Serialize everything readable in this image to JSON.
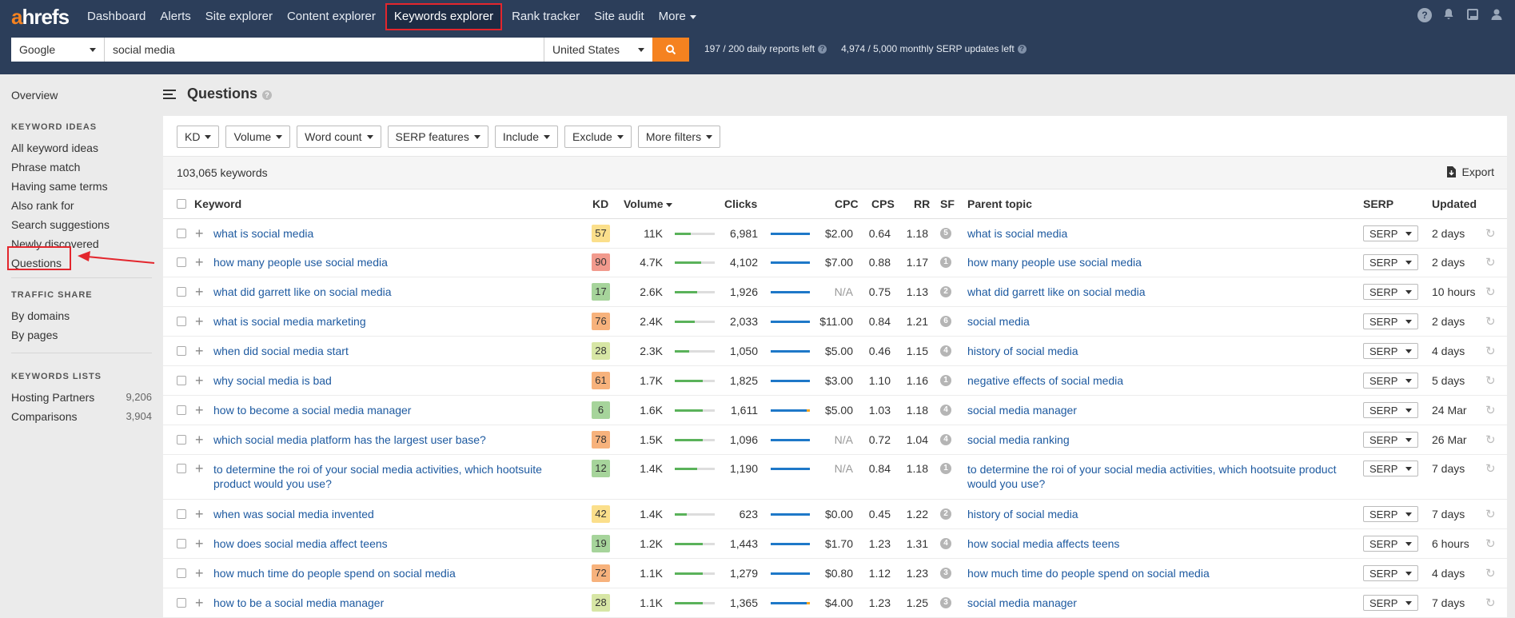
{
  "brand": {
    "logo_first": "a",
    "logo_rest": "hrefs",
    "accent": "#f58220",
    "nav_bg": "#2c3e5a"
  },
  "nav": {
    "items": [
      "Dashboard",
      "Alerts",
      "Site explorer",
      "Content explorer",
      "Keywords explorer",
      "Rank tracker",
      "Site audit",
      "More"
    ],
    "active": "Keywords explorer"
  },
  "top_icons": [
    "help-icon",
    "bell-icon",
    "book-icon",
    "user-icon"
  ],
  "search": {
    "engine": "Google",
    "query": "social media",
    "country": "United States",
    "daily_reports": "197 / 200 daily reports left",
    "monthly_updates": "4,974 / 5,000 monthly SERP updates left"
  },
  "sidebar": {
    "overview": "Overview",
    "keyword_ideas_heading": "KEYWORD IDEAS",
    "keyword_ideas": [
      "All keyword ideas",
      "Phrase match",
      "Having same terms",
      "Also rank for",
      "Search suggestions",
      "Newly discovered",
      "Questions"
    ],
    "traffic_share_heading": "TRAFFIC SHARE",
    "traffic_share": [
      "By domains",
      "By pages"
    ],
    "lists_heading": "KEYWORDS LISTS",
    "lists": [
      {
        "name": "Hosting Partners",
        "count": "9,206"
      },
      {
        "name": "Comparisons",
        "count": "3,904"
      }
    ]
  },
  "page": {
    "title": "Questions",
    "keyword_count": "103,065 keywords",
    "export_label": "Export"
  },
  "filters": [
    "KD",
    "Volume",
    "Word count",
    "SERP features",
    "Include",
    "Exclude",
    "More filters"
  ],
  "columns": {
    "keyword": "Keyword",
    "kd": "KD",
    "volume": "Volume",
    "clicks": "Clicks",
    "cpc": "CPC",
    "cps": "CPS",
    "rr": "RR",
    "sf": "SF",
    "parent_topic": "Parent topic",
    "serp": "SERP",
    "updated": "Updated"
  },
  "kd_colors": {
    "easy": "#a6d49b",
    "low": "#d7e6a5",
    "medium": "#fbdf8b",
    "hard": "#f7b27c",
    "super_hard": "#f29a8d"
  },
  "rows": [
    {
      "keyword": "what is social media",
      "kd": "57",
      "kd_color": "#fbdf8b",
      "volume": "11K",
      "vol_fill": 0.4,
      "clicks": "6,981",
      "paid": 0,
      "cpc": "$2.00",
      "cps": "0.64",
      "rr": "1.18",
      "sf": "5",
      "parent": "what is social media",
      "serp": "SERP",
      "updated": "2 days"
    },
    {
      "keyword": "how many people use social media",
      "kd": "90",
      "kd_color": "#f29a8d",
      "volume": "4.7K",
      "vol_fill": 0.65,
      "clicks": "4,102",
      "paid": 0,
      "cpc": "$7.00",
      "cps": "0.88",
      "rr": "1.17",
      "sf": "1",
      "parent": "how many people use social media",
      "serp": "SERP",
      "updated": "2 days"
    },
    {
      "keyword": "what did garrett like on social media",
      "kd": "17",
      "kd_color": "#a6d49b",
      "volume": "2.6K",
      "vol_fill": 0.55,
      "clicks": "1,926",
      "paid": 0,
      "cpc": "N/A",
      "cps": "0.75",
      "rr": "1.13",
      "sf": "2",
      "parent": "what did garrett like on social media",
      "serp": "SERP",
      "updated": "10 hours"
    },
    {
      "keyword": "what is social media marketing",
      "kd": "76",
      "kd_color": "#f7b27c",
      "volume": "2.4K",
      "vol_fill": 0.5,
      "clicks": "2,033",
      "paid": 0,
      "cpc": "$11.00",
      "cps": "0.84",
      "rr": "1.21",
      "sf": "6",
      "parent": "social media",
      "serp": "SERP",
      "updated": "2 days"
    },
    {
      "keyword": "when did social media start",
      "kd": "28",
      "kd_color": "#d7e6a5",
      "volume": "2.3K",
      "vol_fill": 0.35,
      "clicks": "1,050",
      "paid": 0,
      "cpc": "$5.00",
      "cps": "0.46",
      "rr": "1.15",
      "sf": "4",
      "parent": "history of social media",
      "serp": "SERP",
      "updated": "4 days"
    },
    {
      "keyword": "why social media is bad",
      "kd": "61",
      "kd_color": "#f7b27c",
      "volume": "1.7K",
      "vol_fill": 0.7,
      "clicks": "1,825",
      "paid": 0,
      "cpc": "$3.00",
      "cps": "1.10",
      "rr": "1.16",
      "sf": "1",
      "parent": "negative effects of social media",
      "serp": "SERP",
      "updated": "5 days"
    },
    {
      "keyword": "how to become a social media manager",
      "kd": "6",
      "kd_color": "#a6d49b",
      "volume": "1.6K",
      "vol_fill": 0.7,
      "clicks": "1,611",
      "paid": 0.08,
      "cpc": "$5.00",
      "cps": "1.03",
      "rr": "1.18",
      "sf": "4",
      "parent": "social media manager",
      "serp": "SERP",
      "updated": "24 Mar"
    },
    {
      "keyword": "which social media platform has the largest user base?",
      "kd": "78",
      "kd_color": "#f7b27c",
      "volume": "1.5K",
      "vol_fill": 0.7,
      "clicks": "1,096",
      "paid": 0,
      "cpc": "N/A",
      "cps": "0.72",
      "rr": "1.04",
      "sf": "4",
      "parent": "social media ranking",
      "serp": "SERP",
      "updated": "26 Mar"
    },
    {
      "keyword": "to determine the roi of your social media activities, which hootsuite product would you use?",
      "kd": "12",
      "kd_color": "#a6d49b",
      "volume": "1.4K",
      "vol_fill": 0.55,
      "clicks": "1,190",
      "paid": 0,
      "cpc": "N/A",
      "cps": "0.84",
      "rr": "1.18",
      "sf": "1",
      "parent": "to determine the roi of your social media activities, which hootsuite product would you use?",
      "serp": "SERP",
      "updated": "7 days"
    },
    {
      "keyword": "when was social media invented",
      "kd": "42",
      "kd_color": "#fbdf8b",
      "volume": "1.4K",
      "vol_fill": 0.3,
      "clicks": "623",
      "paid": 0,
      "cpc": "$0.00",
      "cps": "0.45",
      "rr": "1.22",
      "sf": "2",
      "parent": "history of social media",
      "serp": "SERP",
      "updated": "7 days"
    },
    {
      "keyword": "how does social media affect teens",
      "kd": "19",
      "kd_color": "#a6d49b",
      "volume": "1.2K",
      "vol_fill": 0.7,
      "clicks": "1,443",
      "paid": 0,
      "cpc": "$1.70",
      "cps": "1.23",
      "rr": "1.31",
      "sf": "4",
      "parent": "how social media affects teens",
      "serp": "SERP",
      "updated": "6 hours"
    },
    {
      "keyword": "how much time do people spend on social media",
      "kd": "72",
      "kd_color": "#f7b27c",
      "volume": "1.1K",
      "vol_fill": 0.7,
      "clicks": "1,279",
      "paid": 0,
      "cpc": "$0.80",
      "cps": "1.12",
      "rr": "1.23",
      "sf": "3",
      "parent": "how much time do people spend on social media",
      "serp": "SERP",
      "updated": "4 days"
    },
    {
      "keyword": "how to be a social media manager",
      "kd": "28",
      "kd_color": "#d7e6a5",
      "volume": "1.1K",
      "vol_fill": 0.7,
      "clicks": "1,365",
      "paid": 0.08,
      "cpc": "$4.00",
      "cps": "1.23",
      "rr": "1.25",
      "sf": "3",
      "parent": "social media manager",
      "serp": "SERP",
      "updated": "7 days"
    }
  ]
}
